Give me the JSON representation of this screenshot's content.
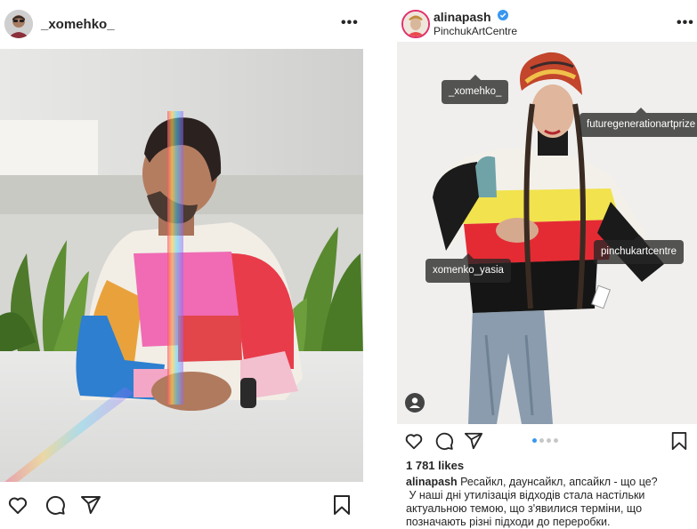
{
  "post_left": {
    "username": "_xomehko_",
    "more_glyph": "•••"
  },
  "post_right": {
    "username": "alinapash",
    "location": "PinchukArtCentre",
    "more_glyph": "•••",
    "tags": {
      "tag1": "_xomehko_",
      "tag2": "futuregenerationartprize",
      "tag3": "pinchukartcentre",
      "tag4": "xomenko_yasia"
    },
    "carousel": {
      "total": 4,
      "active_index": 0
    },
    "likes": "1 781 likes",
    "caption_user": "alinapash",
    "caption_line1": " Ресайкл, даунсайкл, апсайкл - що це?",
    "caption_line2": " У наші дні утилізація відходів стала настільки",
    "caption_line3": "актуальною темою, що з'явилися терміни, що",
    "caption_line4": "позначають різні підходи до переробки."
  },
  "colors": {
    "text": "#262626",
    "verified": "#3897f0",
    "tag_bg": "#262626",
    "carousel_active": "#3897f0",
    "carousel_inactive": "#c7c7c7"
  },
  "icons": [
    "heart-icon",
    "comment-icon",
    "share-icon",
    "bookmark-icon",
    "verified-badge-icon",
    "user-tag-icon"
  ]
}
